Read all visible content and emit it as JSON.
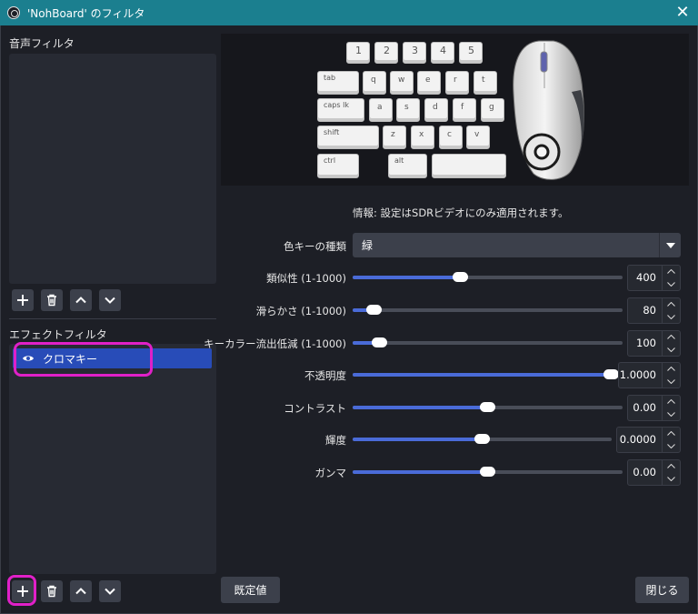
{
  "window": {
    "title": "'NohBoard' のフィルタ",
    "close_glyph": "✕"
  },
  "audio_filters": {
    "label": "音声フィルタ",
    "items": []
  },
  "effect_filters": {
    "label": "エフェクトフィルタ",
    "items": [
      {
        "name": "クロマキー",
        "visible": true
      }
    ]
  },
  "preview": {
    "number_keys": [
      "1",
      "2",
      "3",
      "4",
      "5"
    ],
    "row_tab": [
      "tab",
      "q",
      "w",
      "e",
      "r",
      "t"
    ],
    "row_caps": [
      "caps lk",
      "a",
      "s",
      "d",
      "f",
      "g"
    ],
    "row_shift": [
      "shift",
      "z",
      "x",
      "c",
      "v"
    ],
    "row_ctrl": [
      "ctrl",
      "alt"
    ]
  },
  "info": "情報: 設定はSDRビデオにのみ適用されます。",
  "properties": {
    "key_color_type": {
      "label": "色キーの種類",
      "value": "緑"
    },
    "similarity": {
      "label": "類似性 (1-1000)",
      "value": "400",
      "fraction": 0.4
    },
    "smoothness": {
      "label": "滑らかさ (1-1000)",
      "value": "80",
      "fraction": 0.08
    },
    "spill": {
      "label": "キーカラー流出低減 (1-1000)",
      "value": "100",
      "fraction": 0.1
    },
    "opacity": {
      "label": "不透明度",
      "value": "1.0000",
      "fraction": 1.0
    },
    "contrast": {
      "label": "コントラスト",
      "value": "0.00",
      "fraction": 0.5
    },
    "brightness": {
      "label": "輝度",
      "value": "0.0000",
      "fraction": 0.5
    },
    "gamma": {
      "label": "ガンマ",
      "value": "0.00",
      "fraction": 0.5
    }
  },
  "buttons": {
    "defaults": "既定値",
    "close": "閉じる"
  },
  "colors": {
    "titlebar": "#1b7f8f",
    "accent": "#284cb8",
    "slider_fill": "#4a6bd8",
    "highlight": "#e020c8"
  }
}
